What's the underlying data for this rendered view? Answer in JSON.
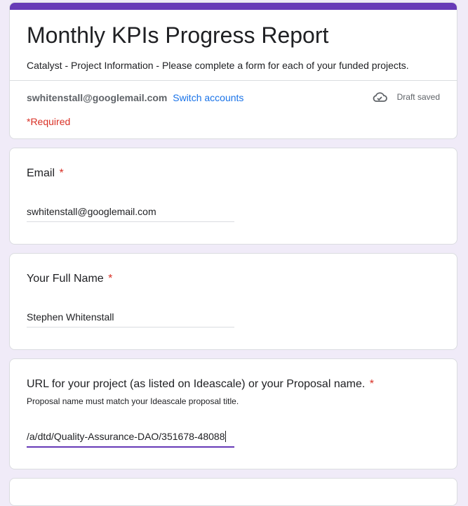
{
  "header": {
    "title": "Monthly KPIs Progress Report",
    "description": "Catalyst - Project Information - Please complete a form for each of your funded projects.",
    "account_email": "swhitenstall@googlemail.com",
    "switch_accounts": "Switch accounts",
    "draft_status": "Draft saved",
    "required_note": "*Required"
  },
  "questions": [
    {
      "label": "Email",
      "required_mark": "*",
      "value": "swhitenstall@googlemail.com"
    },
    {
      "label": "Your Full Name",
      "required_mark": "*",
      "value": "Stephen Whitenstall"
    },
    {
      "label": "URL for your project (as listed on Ideascale) or your Proposal name.",
      "required_mark": "*",
      "help": "Proposal name must match your Ideascale proposal title.",
      "value": "/a/dtd/Quality-Assurance-DAO/351678-48088"
    }
  ],
  "colors": {
    "accent": "#673ab7",
    "background": "#f0ebf8",
    "required": "#d93025",
    "link": "#1a73e8"
  },
  "icons": {
    "draft": "cloud-check-icon"
  }
}
